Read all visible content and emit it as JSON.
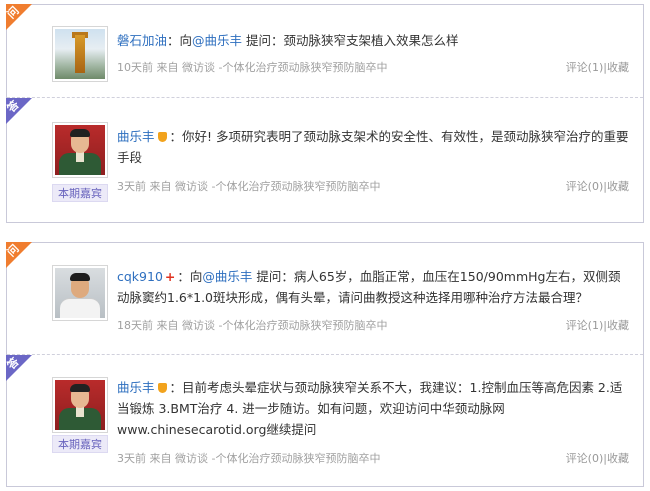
{
  "labels": {
    "ask_corner": "问",
    "answer_corner": "答",
    "guest_badge": "本期嘉宾"
  },
  "threads": [
    {
      "question": {
        "user": "磐石加油",
        "connector": "：向",
        "mention": "@曲乐丰",
        "text": " 提问：颈动脉狭窄支架植入效果怎么样",
        "time": "10天前",
        "source": "来自 微访谈 -个体化治疗颈动脉狭窄预防脑卒中",
        "comment": "评论(1)",
        "sep": "|",
        "fav": "收藏"
      },
      "answer": {
        "user": "曲乐丰",
        "text": "：你好! 多项研究表明了颈动脉支架术的安全性、有效性，是颈动脉狭窄治疗的重要手段",
        "time": "3天前",
        "source": "来自 微访谈 -个体化治疗颈动脉狭窄预防脑卒中",
        "comment": "评论(0)",
        "sep": "|",
        "fav": "收藏"
      }
    },
    {
      "question": {
        "user": "cqk910",
        "plus": "+",
        "connector": "：向",
        "mention": "@曲乐丰",
        "text": " 提问：病人65岁，血脂正常，血压在150/90mmHg左右，双侧颈动脉窦约1.6*1.0斑块形成，偶有头晕，请问曲教授这种选择用哪种治疗方法最合理？",
        "time": "18天前",
        "source": "来自 微访谈 -个体化治疗颈动脉狭窄预防脑卒中",
        "comment": "评论(1)",
        "sep": "|",
        "fav": "收藏"
      },
      "answer": {
        "user": "曲乐丰",
        "text": "：目前考虑头晕症状与颈动脉狭窄关系不大，我建议：1.控制血压等高危因素 2.适当锻炼 3.BMT治疗 4. 进一步随访。如有问题，欢迎访问中华颈动脉网www.chinesecarotid.org继续提问",
        "time": "3天前",
        "source": "来自 微访谈 -个体化治疗颈动脉狭窄预防脑卒中",
        "comment": "评论(0)",
        "sep": "|",
        "fav": "收藏"
      }
    }
  ]
}
